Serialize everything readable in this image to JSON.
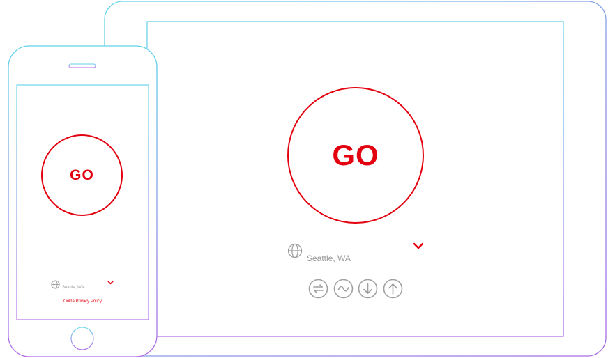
{
  "tablet": {
    "go_label": "GO",
    "location": "Seattle, WA",
    "icons": [
      "connections-icon",
      "ping-icon",
      "download-icon",
      "upload-icon"
    ]
  },
  "phone": {
    "go_label": "GO",
    "location": "Seattle, WA",
    "privacy_link": "Ookla Privacy Policy"
  },
  "colors": {
    "accent": "#e3000f",
    "icon_gray": "#a0a0a0",
    "frame_cyan": "#5fd3e6",
    "frame_purple": "#a86be6"
  }
}
